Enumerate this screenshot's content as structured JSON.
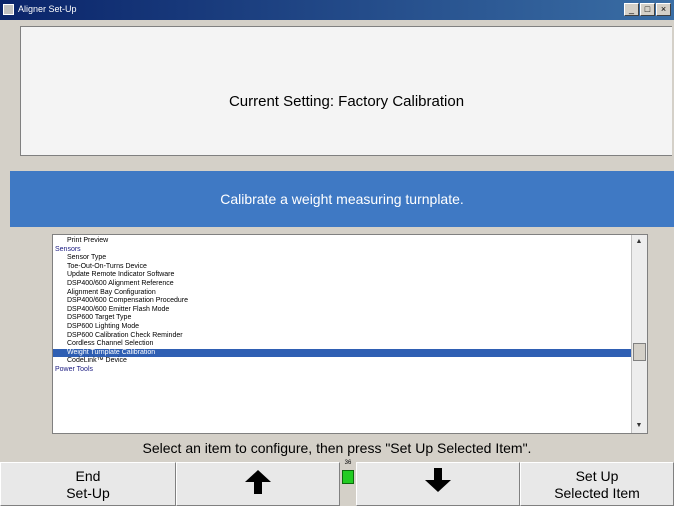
{
  "window": {
    "title": "Aligner Set-Up",
    "controls": [
      "minimize-icon",
      "maximize-icon",
      "close-icon"
    ]
  },
  "current_setting": "Current Setting: Factory Calibration",
  "description": "Calibrate a weight measuring turnplate.",
  "list": {
    "items": [
      {
        "label": "Print Preview",
        "type": "item"
      },
      {
        "label": "Sensors",
        "type": "category"
      },
      {
        "label": "Sensor Type",
        "type": "item"
      },
      {
        "label": "Toe-Out-On-Turns Device",
        "type": "item"
      },
      {
        "label": "Update Remote Indicator Software",
        "type": "item"
      },
      {
        "label": "DSP400/600 Alignment Reference",
        "type": "item"
      },
      {
        "label": "Alignment Bay Configuration",
        "type": "item"
      },
      {
        "label": "DSP400/600 Compensation Procedure",
        "type": "item"
      },
      {
        "label": "DSP400/600 Emitter Flash Mode",
        "type": "item"
      },
      {
        "label": "DSP600 Target Type",
        "type": "item"
      },
      {
        "label": "DSP600 Lighting Mode",
        "type": "item"
      },
      {
        "label": "DSP600 Calibration Check Reminder",
        "type": "item"
      },
      {
        "label": "Cordless Channel Selection",
        "type": "item"
      },
      {
        "label": "Weight Turnplate Calibration",
        "type": "item",
        "selected": true
      },
      {
        "label": "CodeLink™ Device",
        "type": "item"
      },
      {
        "label": "Power Tools",
        "type": "category"
      }
    ],
    "scroll_up_icon": "triangle-up-icon",
    "scroll_down_icon": "triangle-down-icon"
  },
  "instruction": "Select an item to configure, then press \"Set Up Selected Item\".",
  "buttons": {
    "end_setup": {
      "line1": "End",
      "line2": "Set-Up"
    },
    "up_icon": "arrow-up-icon",
    "down_icon": "arrow-down-icon",
    "set_up_selected": {
      "line1": "Set Up",
      "line2": "Selected Item"
    }
  },
  "indicator": {
    "number": "36",
    "color": "#22cc22"
  },
  "colors": {
    "description_bar": "#3f79c4",
    "selection": "#2f5fb3"
  }
}
